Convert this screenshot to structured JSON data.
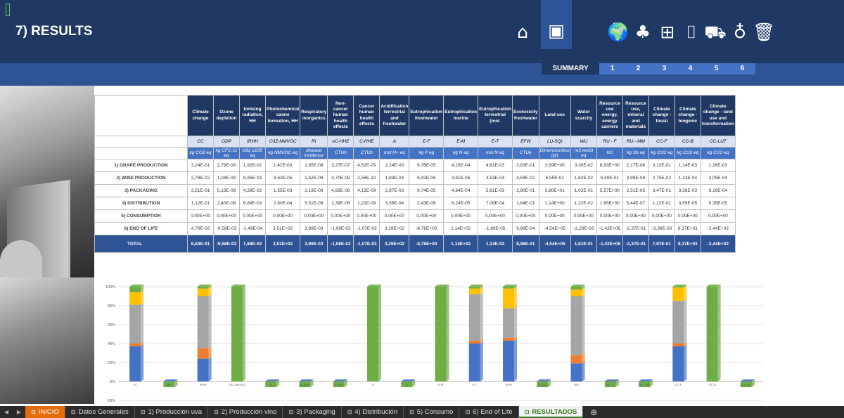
{
  "header": {
    "title": "7) RESULTS",
    "icons": [
      "home-icon",
      "presentation-icon",
      "globe-icon",
      "grapes-icon",
      "wine-press-icon",
      "bottle-icon",
      "truck-icon",
      "wine-glass-icon",
      "trash-icon"
    ],
    "icon_glyphs": {
      "home": "⌂",
      "presentation": "▣",
      "globe": "🌍",
      "grapes": "♣",
      "press": "⊞",
      "bottle": "⌷",
      "truck": "⛟",
      "glass": "♁",
      "trash": "🗑"
    }
  },
  "tabs": {
    "summary": "SUMMARY",
    "numbers": [
      "1",
      "2",
      "3",
      "4",
      "5",
      "6"
    ]
  },
  "table": {
    "headers": [
      "Climate change",
      "Ozone depletion",
      "Ionising radiation, HH",
      "Photochemical ozone formation, HH",
      "Respiratory inorganics",
      "Non-cancer human health effects",
      "Cancer human health effects",
      "Acidification terrestrial and freshwater",
      "Eutrophication freshwater",
      "Eutrophication marine",
      "Eutrophication terrestrial (mol.",
      "Ecotoxicity freshwater",
      "Land use",
      "Water scarcity",
      "Resource use energy, energy carriers",
      "Resource use, mineral and materials",
      "Climate change - fossil",
      "Climate change - biogenic",
      "Climate change - land use and transformation"
    ],
    "abbr": [
      "CC",
      "ODP",
      "IRHH",
      "O3Z-NMVOC",
      "RI",
      "nC-HHE",
      "C-HHE",
      "A",
      "E-F",
      "E-M",
      "E-T",
      "EFW",
      "LU-SQI",
      "WU",
      "RU - F",
      "RU - MM",
      "CC-F",
      "CC-B",
      "CC-LUT"
    ],
    "units": [
      "kg CO2 eq",
      "kg CFC-11 eq",
      "kBq U235 eq",
      "kg NMVOC eq",
      "disease incidence",
      "CTUh",
      "CTUh",
      "mol H+ eq",
      "kg P eq",
      "kg N eq",
      "mol N eq",
      "CTUe",
      "Dimensionless (pt)",
      "m3 world eq",
      "MJ",
      "kg Sb eq",
      "kg CO2 eq",
      "kg CO2 eq",
      "kg CO2 eq"
    ],
    "rows": [
      {
        "label": "1) GRAPE PRODUCTION",
        "values": [
          "3,24E-01",
          "2,79E-08",
          "1,92E-02",
          "1,42E-03",
          "1,65E-08",
          "3,27E-07",
          "4,52E-09",
          "2,24E-03",
          "6,76E-05",
          "4,16E-04",
          "4,61E-03",
          "3,83E-01",
          "3,69E+00",
          "3,30E-02",
          "8,93E+00",
          "2,17E-06",
          "3,13E-01",
          "1,14E-03",
          "1,26E-03"
        ]
      },
      {
        "label": "2) WINE PRODUCTION",
        "values": [
          "2,78E-02",
          "1,04E-08",
          "8,95E-03",
          "9,62E-05",
          "1,52E-09",
          "4,70E-09",
          "2,56E-10",
          "1,83E-04",
          "6,92E-06",
          "3,61E-05",
          "3,53E-04",
          "4,84E-02",
          "6,55E-01",
          "1,62E-02",
          "5,49E-01",
          "3,99E-08",
          "2,75E-02",
          "1,13E-04",
          "2,05E-04"
        ]
      },
      {
        "label": "3) PACKAGING",
        "values": [
          "3,51E-01",
          "5,13E-08",
          "4,39E-02",
          "1,55E-03",
          "2,19E-08",
          "4,69E-08",
          "4,15E-09",
          "2,87E-03",
          "9,74E-05",
          "4,84E-04",
          "5,61E-03",
          "2,80E-01",
          "3,80E+01",
          "1,02E-01",
          "5,57E+00",
          "2,51E-05",
          "3,47E-01",
          "3,26E-03",
          "6,10E-04"
        ]
      },
      {
        "label": "4) DISTRIBUTION",
        "values": [
          "1,12E-01",
          "2,40E-08",
          "6,89E-03",
          "2,60E-04",
          "5,51E-09",
          "1,39E-08",
          "1,21E-09",
          "3,59E-04",
          "2,43E-06",
          "6,24E-05",
          "7,06E-04",
          "1,84E-01",
          "1,14E+00",
          "1,22E-02",
          "1,65E+00",
          "5,44E-07",
          "1,12E-01",
          "3,55E-05",
          "5,35E-05"
        ]
      },
      {
        "label": "5) CONSUMPTION",
        "values": [
          "0,00E+00",
          "0,00E+00",
          "0,00E+00",
          "0,00E+00",
          "0,00E+00",
          "0,00E+00",
          "0,00E+00",
          "0,00E+00",
          "0,00E+00",
          "0,00E+00",
          "0,00E+00",
          "0,00E+00",
          "0,00E+00",
          "0,00E+00",
          "0,00E+00",
          "0,00E+00",
          "0,00E+00",
          "0,00E+00",
          "0,00E+00"
        ]
      },
      {
        "label": "6) END OF LIFE",
        "values": [
          "4,76E-02",
          "-9,58E-03",
          "-1,49E-04",
          "3,51E+02",
          "3,99E-03",
          "-1,08E-02",
          "-1,07E-03",
          "3,29E+02",
          "-8,76E+00",
          "1,14E+02",
          "-1,89E-05",
          "9,98E-04",
          "-4,54E+05",
          "-2,29E-03",
          "-1,43E+06",
          "-2,37E-01",
          "-3,36E-03",
          "9,37E+01",
          "-2,44E+02"
        ]
      }
    ],
    "total": {
      "label": "TOTAL",
      "values": [
        "8,63E-01",
        "-9,58E-03",
        "7,88E-02",
        "3,51E+02",
        "3,99E-03",
        "-1,08E-02",
        "-1,07E-03",
        "3,29E+02",
        "-8,76E+00",
        "1,14E+02",
        "1,13E-02",
        "8,96E-01",
        "-4,54E+05",
        "1,61E-01",
        "-1,43E+06",
        "-2,37E-01",
        "7,97E-01",
        "9,37E+01",
        "-2,44E+02"
      ]
    }
  },
  "chart_data": {
    "type": "bar",
    "stacked": true,
    "percent": true,
    "categories": [
      "CC",
      "ODP",
      "IRHH",
      "O3Z-NMVOC",
      "RI",
      "nC-HHE",
      "C-HHE",
      "A",
      "E-F",
      "E-M",
      "E-T",
      "EFW",
      "LU-SQI",
      "WU",
      "RU - F",
      "RU - MM",
      "CC-F",
      "CC-B",
      "CC-LUT"
    ],
    "yticks": [
      "100%",
      "80%",
      "60%",
      "40%",
      "20%",
      "0%",
      "-20%"
    ],
    "ylim": [
      -20,
      100
    ],
    "colors": [
      "#4472c4",
      "#ed7d31",
      "#a5a5a5",
      "#ffc000",
      "#5b9bd5",
      "#70ad47"
    ],
    "series": [
      {
        "values": [
          37,
          0,
          24,
          0,
          0,
          0,
          0,
          0,
          0,
          0,
          40,
          43,
          0,
          19,
          0,
          0,
          37,
          0,
          0
        ]
      },
      {
        "values": [
          3,
          0,
          11,
          0,
          0,
          0,
          0,
          0,
          0,
          0,
          3,
          3,
          0,
          9,
          0,
          0,
          3,
          0,
          0
        ]
      },
      {
        "values": [
          41,
          0,
          55,
          0,
          0,
          0,
          0,
          0,
          0,
          0,
          49,
          31,
          0,
          62,
          0,
          0,
          45,
          0,
          0
        ]
      },
      {
        "values": [
          13,
          0,
          8,
          0,
          0,
          0,
          0,
          0,
          0,
          0,
          6,
          21,
          0,
          7,
          0,
          0,
          14,
          0,
          0
        ]
      },
      {
        "values": [
          0,
          0,
          0,
          0,
          0,
          0,
          0,
          0,
          0,
          0,
          0,
          0,
          0,
          0,
          0,
          0,
          0,
          0,
          0
        ]
      },
      {
        "values": [
          6,
          -6,
          2,
          100,
          -6,
          -6,
          -6,
          100,
          -6,
          100,
          2,
          2,
          -6,
          3,
          -6,
          -6,
          1,
          100,
          -6
        ]
      }
    ]
  },
  "sheet_tabs": [
    "INICIO",
    "Datos Generales",
    "1) Producción uva",
    "2) Producción vino",
    "3) Packaging",
    "4) Distribución",
    "5) Consumo",
    "6) End of Life",
    "RESULTADOS"
  ]
}
